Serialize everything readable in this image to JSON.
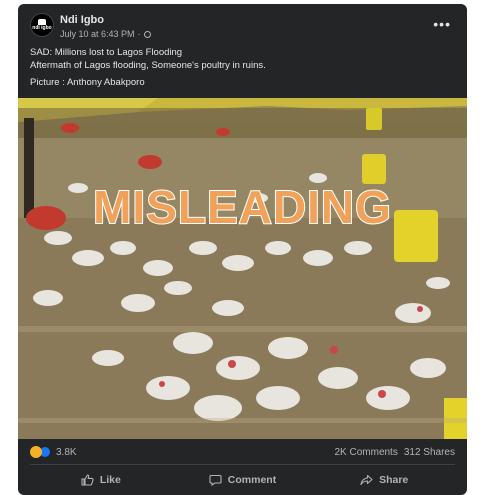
{
  "post": {
    "page_name": "Ndi Igbo",
    "avatar_text": "ndi igbo",
    "timestamp": "July 10 at 6:43 PM",
    "separator": "·",
    "more_label": "•••",
    "caption_line1": "SAD: Millions lost to Lagos Flooding",
    "caption_line2": "Aftermath of Lagos flooding, Someone's poultry in ruins.",
    "caption_credit": "Picture : Anthony Abakporo"
  },
  "image": {
    "stamp_text": "MISLEADING",
    "stamp_color": "#f0a25a"
  },
  "stats": {
    "reaction_count": "3.8K",
    "comments": "2K Comments",
    "shares": "312 Shares"
  },
  "actions": {
    "like_label": "Like",
    "comment_label": "Comment",
    "share_label": "Share"
  },
  "icons": [
    "globe-icon",
    "more-icon",
    "sad-reaction-icon",
    "like-reaction-icon",
    "like-icon",
    "comment-icon",
    "share-icon"
  ]
}
